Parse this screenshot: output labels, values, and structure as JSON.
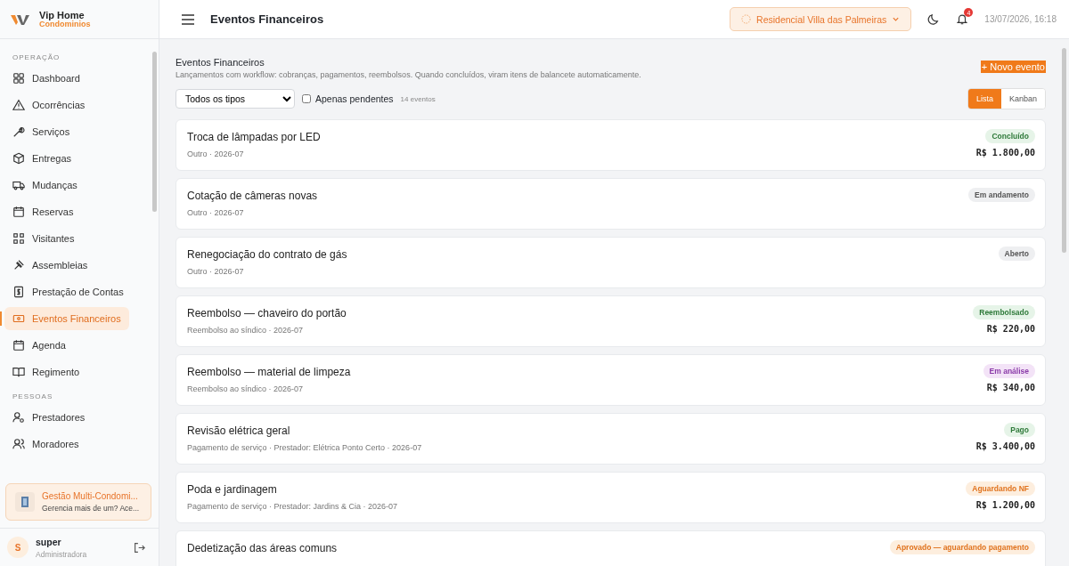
{
  "brand": {
    "name": "Vip Home",
    "tagline": "Condominios"
  },
  "sidebar": {
    "sections": [
      {
        "heading": "OPERAÇÃO",
        "items": [
          {
            "label": "Dashboard",
            "selected": false
          },
          {
            "label": "Ocorrências",
            "selected": false
          },
          {
            "label": "Serviços",
            "selected": false
          },
          {
            "label": "Entregas",
            "selected": false
          },
          {
            "label": "Mudanças",
            "selected": false
          },
          {
            "label": "Reservas",
            "selected": false
          },
          {
            "label": "Visitantes",
            "selected": false
          },
          {
            "label": "Assembleias",
            "selected": false
          },
          {
            "label": "Prestação de Contas",
            "selected": false
          },
          {
            "label": "Eventos Financeiros",
            "selected": true
          },
          {
            "label": "Agenda",
            "selected": false
          },
          {
            "label": "Regimento",
            "selected": false
          }
        ]
      },
      {
        "heading": "PESSOAS",
        "items": [
          {
            "label": "Prestadores",
            "selected": false
          },
          {
            "label": "Moradores",
            "selected": false
          }
        ]
      }
    ],
    "promo": {
      "title": "Gestão Multi-Condomi...",
      "text": "Gerencia mais de um? Ace..."
    },
    "user": {
      "initial": "S",
      "name": "super",
      "role": "Administradora"
    }
  },
  "header": {
    "title": "Eventos Financeiros",
    "condo": "Residencial Villa das Palmeiras",
    "notifications": "4",
    "datetime": "13/07/2026, 16:18"
  },
  "page": {
    "title": "Eventos Financeiros",
    "subtitle": "Lançamentos com workflow: cobranças, pagamentos, reembolsos. Quando concluídos, viram itens de balancete automaticamente.",
    "new_button": "+ Novo evento",
    "filter": {
      "value": "Todos os tipos"
    },
    "pending": {
      "label": "Apenas pendentes",
      "checked": false
    },
    "count": "14 eventos",
    "views": [
      {
        "label": "Lista",
        "selected": true
      },
      {
        "label": "Kanban",
        "selected": false
      }
    ]
  },
  "events": [
    {
      "title": "Troca de lâmpadas por LED",
      "meta": "Outro · 2026-07",
      "status": "Concluído",
      "kind": "success",
      "amount": "R$ 1.800,00"
    },
    {
      "title": "Cotação de câmeras novas",
      "meta": "Outro · 2026-07",
      "status": "Em andamento",
      "kind": "neutral"
    },
    {
      "title": "Renegociação do contrato de gás",
      "meta": "Outro · 2026-07",
      "status": "Aberto",
      "kind": "neutral"
    },
    {
      "title": "Reembolso — chaveiro do portão",
      "meta": "Reembolso ao síndico · 2026-07",
      "status": "Reembolsado",
      "kind": "success",
      "amount": "R$ 220,00"
    },
    {
      "title": "Reembolso — material de limpeza",
      "meta": "Reembolso ao síndico · 2026-07",
      "status": "Em análise",
      "kind": "review",
      "amount": "R$ 340,00"
    },
    {
      "title": "Revisão elétrica geral",
      "meta": "Pagamento de serviço · Prestador: Elétrica Ponto Certo · 2026-07",
      "status": "Pago",
      "kind": "success",
      "amount": "R$ 3.400,00"
    },
    {
      "title": "Poda e jardinagem",
      "meta": "Pagamento de serviço · Prestador: Jardins & Cia · 2026-07",
      "status": "Aguardando NF",
      "kind": "warning",
      "amount": "R$ 1.200,00"
    },
    {
      "title": "Dedetização das áreas comuns",
      "status": "Aprovado — aguardando pagamento",
      "kind": "warning"
    }
  ]
}
